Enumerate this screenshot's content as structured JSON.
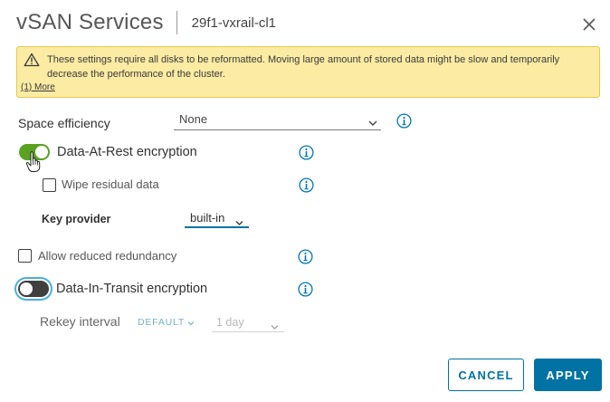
{
  "dialog": {
    "title": "vSAN Services",
    "subtitle": "29f1-vxrail-cl1",
    "close_icon": "close-icon"
  },
  "alert": {
    "icon": "warning-icon",
    "message": "These settings require all disks to be reformatted. Moving large amount of stored data might be slow and temporarily decrease the performance of the cluster.",
    "link_text": "(1) More"
  },
  "space_efficiency": {
    "label": "Space efficiency",
    "value": "None"
  },
  "data_at_rest": {
    "label": "Data-At-Rest encryption",
    "enabled": true,
    "wipe_label": "Wipe residual data",
    "wipe_checked": false,
    "key_provider_label": "Key provider",
    "key_provider_value": "built-in"
  },
  "reduced_redundancy": {
    "label": "Allow reduced redundancy",
    "checked": false
  },
  "data_in_transit": {
    "label": "Data-In-Transit encryption",
    "enabled": false,
    "rekey_label": "Rekey interval",
    "rekey_default": "DEFAULT",
    "rekey_value": "1 day"
  },
  "buttons": {
    "cancel": "CANCEL",
    "apply": "APPLY"
  },
  "colors": {
    "primary": "#0072a3",
    "toggle_on": "#5aa220",
    "toggle_off": "#3f3f3f",
    "warning_bg": "#fbeba3",
    "info_icon": "#0079b8"
  }
}
